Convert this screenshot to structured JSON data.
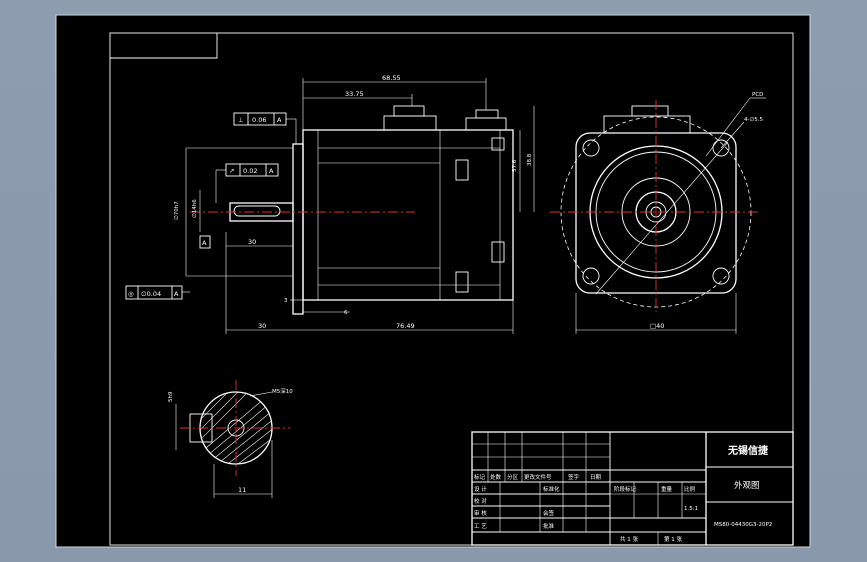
{
  "dims": {
    "total_length": "68.55",
    "upper_length": "33.75",
    "height_a": "57.6",
    "height_b": "38.8",
    "flange_offset": "30",
    "body_length": "76.49",
    "shaft_length": "30",
    "step_3": "3",
    "step_6": "6",
    "key_width": "11",
    "face_width": "□40"
  },
  "tolerances": {
    "perp": {
      "symbol": "⊥",
      "value": "0.06",
      "datum": "A"
    },
    "runout": {
      "symbol": "↗",
      "value": "0.02",
      "datum": "A"
    },
    "concentric": {
      "symbol": "◎",
      "value": "∅0.04",
      "datum": "A"
    },
    "datum_label": "A"
  },
  "labels": {
    "pcd": "PCD",
    "hole": "4-∅5.5"
  },
  "title_block": {
    "company": "无锡信捷",
    "drawing_name": "外观图",
    "drawing_number": "MS80-04430G3-20P2",
    "scale": "1.5:1",
    "sheet_total": "共 1 张",
    "sheet_no": "第 1 张",
    "header_cells": [
      "标记",
      "处数",
      "分区",
      "更改文件号",
      "签字",
      "日期"
    ],
    "rows": [
      "设 计",
      "校 对",
      "审 核",
      "工 艺"
    ],
    "std": "标准化",
    "approve": "批准",
    "check2": "会签",
    "stage": "阶段标记",
    "weight": "重量",
    "ratio": "比例"
  }
}
